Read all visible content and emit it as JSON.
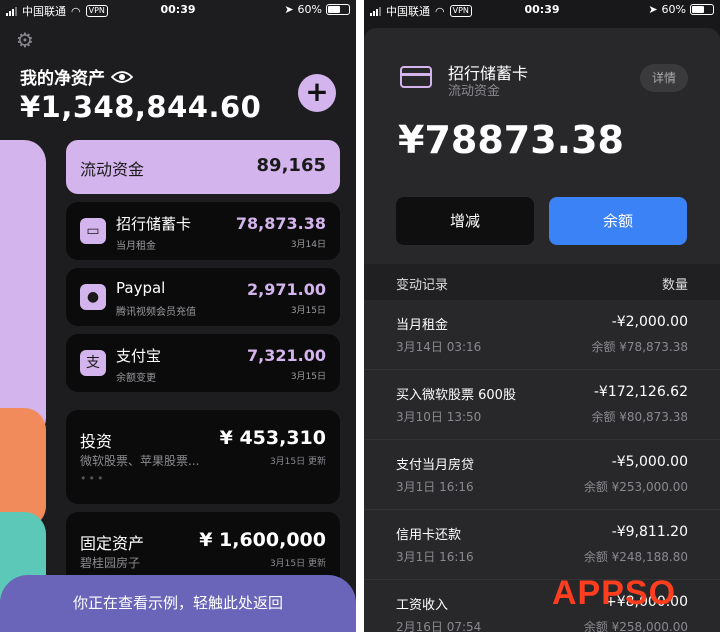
{
  "status_bar": {
    "carrier": "中国联通",
    "vpn": "VPN",
    "time": "00:39",
    "battery": "60%"
  },
  "left": {
    "net_worth_title": "我的净资产",
    "net_worth_amount": "¥1,348,844.60",
    "highlight": {
      "label": "流动资金",
      "value": "89,165"
    },
    "accounts": [
      {
        "name": "招行储蓄卡",
        "sub": "当月租金",
        "value": "78,873.38",
        "date": "3月14日",
        "icon": "bank-card-icon"
      },
      {
        "name": "Paypal",
        "sub": "腾讯视频会员充值",
        "value": "2,971.00",
        "date": "3月15日",
        "icon": "wechat-icon"
      },
      {
        "name": "支付宝",
        "sub": "余额变更",
        "value": "7,321.00",
        "date": "3月15日",
        "icon": "alipay-icon"
      }
    ],
    "investment": {
      "name": "投资",
      "sub": "微软股票、苹果股票...",
      "value": "¥ 453,310",
      "date": "3月15日 更新",
      "dots": "•••"
    },
    "fixed": {
      "name": "固定资产",
      "sub": "碧桂园房子",
      "value": "¥ 1,600,000",
      "date": "3月15日 更新"
    },
    "banner": "你正在查看示例，轻触此处返回",
    "strip_colors": [
      "#d4b4ec",
      "#f28b5c",
      "#5bc8b8"
    ]
  },
  "right": {
    "account_name": "招行储蓄卡",
    "account_type": "流动资金",
    "detail_label": "详情",
    "amount": "¥78873.38",
    "btn_adjust": "增减",
    "btn_balance": "余额",
    "log_header": "变动记录",
    "log_qty": "数量",
    "rows": [
      {
        "title": "当月租金",
        "amount": "-¥2,000.00",
        "date": "3月14日 03:16",
        "balance": "余额 ¥78,873.38"
      },
      {
        "title": "买入微软股票 600股",
        "amount": "-¥172,126.62",
        "date": "3月10日 13:50",
        "balance": "余额 ¥80,873.38"
      },
      {
        "title": "支付当月房贷",
        "amount": "-¥5,000.00",
        "date": "3月1日 16:16",
        "balance": "余额 ¥253,000.00"
      },
      {
        "title": "信用卡还款",
        "amount": "-¥9,811.20",
        "date": "3月1日 16:16",
        "balance": "余额 ¥248,188.80"
      },
      {
        "title": "工资收入",
        "amount": "+¥8,000.00",
        "date": "2月16日 07:54",
        "balance": "余额 ¥258,000.00"
      }
    ]
  },
  "watermark": "APPSO",
  "colors": {
    "accent": "#d4b4ec",
    "blue": "#3b82f6",
    "banner": "#6a65b8",
    "watermark": "#ff3d1f"
  }
}
